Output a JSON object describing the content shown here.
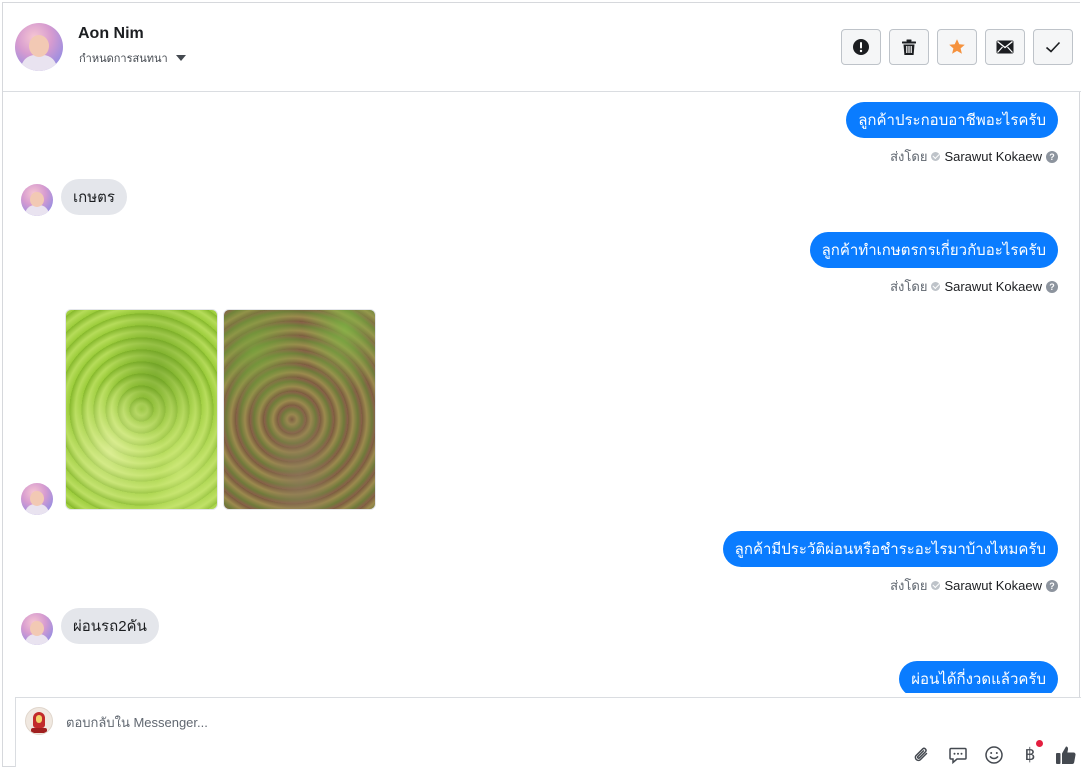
{
  "header": {
    "contact_name": "Aon Nim",
    "assign_label": "กำหนดการสนทนา",
    "actions": [
      {
        "name": "report-spam-button",
        "icon": "exclamation-icon"
      },
      {
        "name": "delete-button",
        "icon": "trash-icon"
      },
      {
        "name": "star-button",
        "icon": "star-icon"
      },
      {
        "name": "mark-unread-button",
        "icon": "envelope-icon"
      },
      {
        "name": "mark-done-button",
        "icon": "checkmark-icon"
      }
    ]
  },
  "messages": {
    "m1": {
      "direction": "outgoing",
      "text": "ลูกค้าประกอบอาชีพอะไรครับ"
    },
    "m1_sent": {
      "prefix": "ส่งโดย",
      "agent": "Sarawut Kokaew"
    },
    "m2": {
      "direction": "incoming",
      "text": "เกษตร"
    },
    "m3": {
      "direction": "outgoing",
      "text": "ลูกค้าทำเกษตรกรเกี่ยวกับอะไรครับ"
    },
    "m3_sent": {
      "prefix": "ส่งโดย",
      "agent": "Sarawut Kokaew"
    },
    "m4": {
      "direction": "incoming",
      "type": "photos",
      "count": 2
    },
    "m5": {
      "direction": "outgoing",
      "text": "ลูกค้ามีประวัติผ่อนหรือชำระอะไรมาบ้างไหมครับ"
    },
    "m5_sent": {
      "prefix": "ส่งโดย",
      "agent": "Sarawut Kokaew"
    },
    "m6": {
      "direction": "incoming",
      "text": "ผ่อนรถ2คัน"
    },
    "m7": {
      "direction": "outgoing",
      "text": "ผ่อนได้กี่งวดแล้วครับ"
    }
  },
  "composer": {
    "placeholder": "ตอบกลับใน Messenger...",
    "tools": [
      "paperclip-icon",
      "saved-reply-icon",
      "emoji-icon",
      "baht-payment-icon",
      "thumbs-up-icon"
    ],
    "baht_symbol": "฿"
  },
  "colors": {
    "outgoing_bubble": "#0a7cff",
    "incoming_bubble": "#e4e6eb",
    "star_accent": "#f5923e",
    "notification_dot": "#e41e3f"
  }
}
